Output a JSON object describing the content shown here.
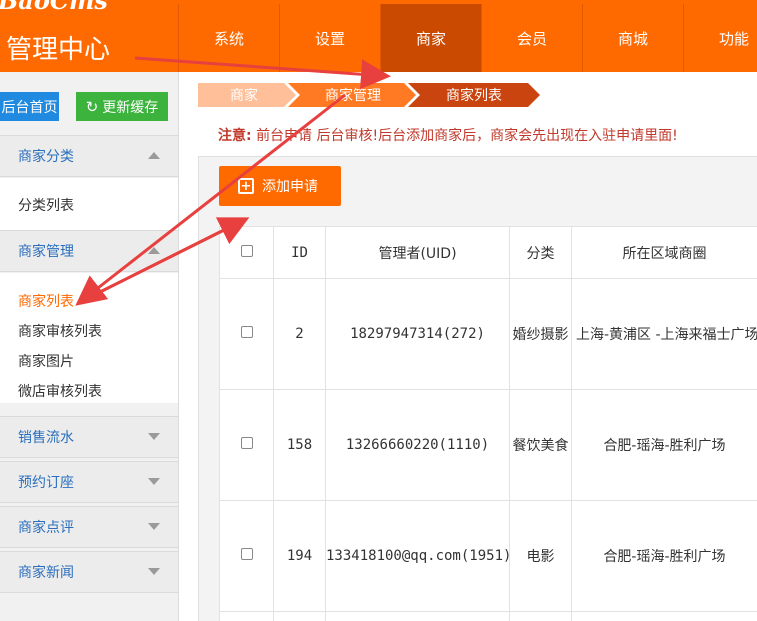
{
  "header": {
    "logo_text": "BaoCms",
    "admin_title": "管理中心",
    "nav": [
      "系统",
      "设置",
      "商家",
      "会员",
      "商城",
      "功能"
    ],
    "nav_active": "商家"
  },
  "sidebar": {
    "btn_home": "后台首页",
    "btn_refresh": "更新缓存",
    "refresh_icon": "refresh-icon",
    "groups": [
      {
        "title": "商家分类",
        "items": [
          "分类列表"
        ]
      },
      {
        "title": "商家管理",
        "items": [
          "商家列表",
          "商家审核列表",
          "商家图片",
          "微店审核列表"
        ],
        "active_item": "商家列表"
      },
      {
        "title": "销售流水"
      },
      {
        "title": "预约订座"
      },
      {
        "title": "商家点评"
      },
      {
        "title": "商家新闻"
      }
    ]
  },
  "breadcrumb": [
    "商家",
    "商家管理",
    "商家列表"
  ],
  "notice": {
    "label": "注意:",
    "text": "前台申请 后台审核!后台添加商家后，商家会先出现在入驻申请里面!"
  },
  "add_button": {
    "label": "添加申请",
    "icon": "plus-square-icon"
  },
  "table": {
    "columns": [
      "ID",
      "管理者(UID)",
      "分类",
      "所在区域商圈"
    ],
    "rows": [
      {
        "id": "2",
        "manager": "18297947314(272)",
        "category": "婚纱摄影",
        "region": "上海-黄浦区 -上海来福士广场"
      },
      {
        "id": "158",
        "manager": "13266660220(1110)",
        "category": "餐饮美食",
        "region": "合肥-瑶海-胜利广场"
      },
      {
        "id": "194",
        "manager": "133418100@qq.com(1951)",
        "category": "电影",
        "region": "合肥-瑶海-胜利广场"
      }
    ]
  },
  "colors": {
    "brand": "#ff6a00",
    "nav_active": "#c94a00",
    "link_blue": "#2b6fbc",
    "btn_blue": "#1f8ae0",
    "btn_green": "#3cb33c",
    "annotation_red": "#e8403e"
  }
}
